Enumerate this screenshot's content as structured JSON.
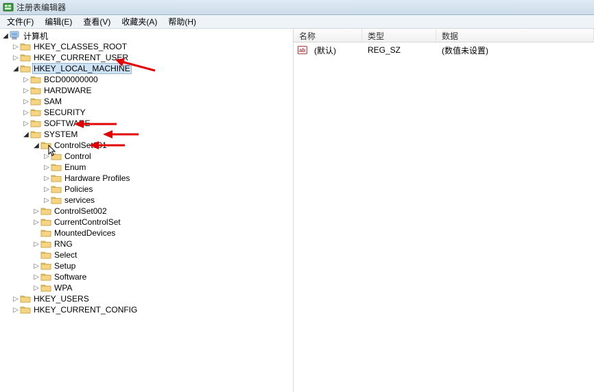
{
  "window": {
    "title": "注册表编辑器"
  },
  "menu": {
    "file": "文件(F)",
    "edit": "编辑(E)",
    "view": "查看(V)",
    "favorites": "收藏夹(A)",
    "help": "帮助(H)"
  },
  "columns": {
    "name": "名称",
    "type": "类型",
    "data": "数据"
  },
  "rows": [
    {
      "name": "(默认)",
      "type": "REG_SZ",
      "data": "(数值未设置)"
    }
  ],
  "tree": {
    "root": "计算机",
    "hkcr": "HKEY_CLASSES_ROOT",
    "hkcu": "HKEY_CURRENT_USER",
    "hklm": "HKEY_LOCAL_MACHINE",
    "hklm_children": {
      "bcd": "BCD00000000",
      "hardware": "HARDWARE",
      "sam": "SAM",
      "security": "SECURITY",
      "software": "SOFTWARE",
      "system": "SYSTEM"
    },
    "system_children": {
      "cs001": "ControlSet001",
      "cs002": "ControlSet002",
      "ccs": "CurrentControlSet",
      "mounted": "MountedDevices",
      "rng": "RNG",
      "select": "Select",
      "setup": "Setup",
      "software": "Software",
      "wpa": "WPA"
    },
    "cs001_children": {
      "control": "Control",
      "enum": "Enum",
      "hwprofiles": "Hardware Profiles",
      "policies": "Policies",
      "services": "services"
    },
    "hku": "HKEY_USERS",
    "hkcc": "HKEY_CURRENT_CONFIG"
  }
}
